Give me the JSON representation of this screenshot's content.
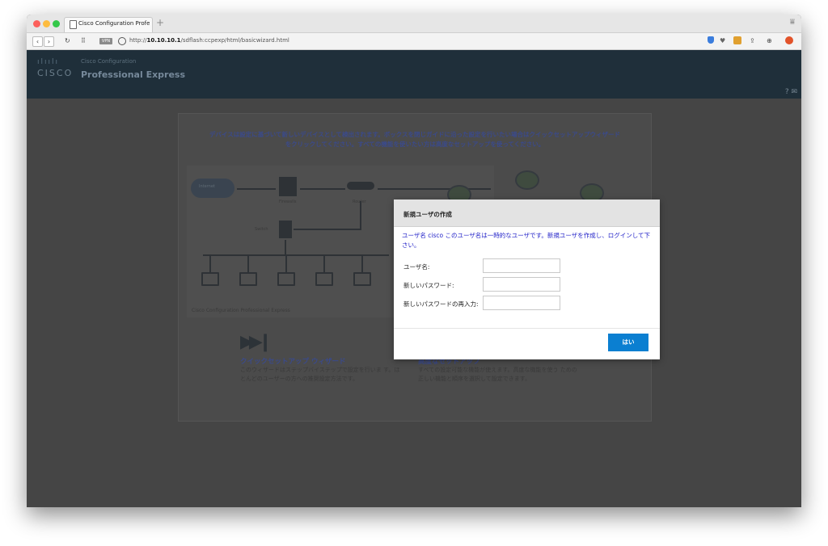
{
  "browser": {
    "tab_title": "Cisco Configuration Professio",
    "new_tab": "+",
    "tab_menu": "⩸",
    "vpn_badge": "VPN",
    "url_prefix": "http://",
    "url_host": "10.10.10.1",
    "url_path": "/sdflash:ccpexp/html/basicwizard.html",
    "colors": {
      "close": "#fc605c",
      "minimize": "#fdbc40",
      "zoom": "#34c84a"
    }
  },
  "header": {
    "logo_bars": "ılıılı",
    "logo_text": "CISCO",
    "product_sub": "Cisco Configuration",
    "product_main": "Professional Express",
    "help": "?"
  },
  "wizard": {
    "intro_line1": "デバイスは設定に基づいて新しいデバイスとして検出されます。ボックスを閉じガイドに沿った設定を行いたい場合はクイックセットアップウィザード",
    "intro_line2": "をクリックしてください。すべての機能を使いたい方は高度なセットアップを使ってください。",
    "diagram": {
      "internet": "Internet",
      "firewall": "Firewalls",
      "router": "Router",
      "switch": "Switch",
      "caption": "Cisco Configuration Professional Express"
    },
    "quick": {
      "title": "クイックセットアップ ウィザード",
      "desc": "このウィザードはステップバイステップで設定を行いま す。ほとんどのユーザーの方への推奨設定方法です。"
    },
    "advanced": {
      "title": "高度なセットアップ",
      "desc": "すべての設定可能な機能が使えます。高度な機能を使う ための正しい機能と順序を選択して設定できます。"
    }
  },
  "dialog": {
    "title": "新規ユーザの作成",
    "message": "ユーザ名 cisco このユーザ名は一時的なユーザです。新規ユーザを作成し、ログインして下さい。",
    "fields": [
      {
        "label": "ユーザ名:",
        "value": ""
      },
      {
        "label": "新しいパスワード:",
        "value": ""
      },
      {
        "label": "新しいパスワードの再入力:",
        "value": ""
      }
    ],
    "ok_label": "はい",
    "accent": "#0b7fd1"
  }
}
